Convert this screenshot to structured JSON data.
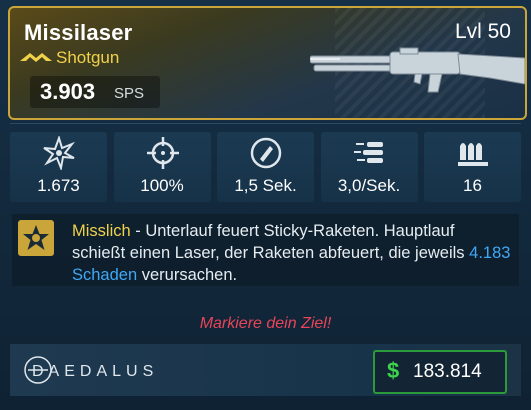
{
  "item": {
    "name": "Missilaser",
    "level": "Lvl 50",
    "type": "Shotgun",
    "dps_value": "3.903",
    "dps_unit": "SPS"
  },
  "stats": [
    {
      "icon": "burst-icon",
      "value": "1.673"
    },
    {
      "icon": "crosshair-icon",
      "value": "100%"
    },
    {
      "icon": "reload-icon",
      "value": "1,5 Sek."
    },
    {
      "icon": "fire-rate-icon",
      "value": "3,0/Sek."
    },
    {
      "icon": "magazine-icon",
      "value": "16"
    }
  ],
  "perk": {
    "name": "Misslich",
    "text_1": " - Unterlauf feuert Sticky-Raketen. Hauptlauf schießt einen Laser, der Raketen abfeuert, die jeweils ",
    "damage": "4.183 Schaden",
    "text_2": " verursachen."
  },
  "flavor_text": "Markiere dein Ziel!",
  "manufacturer": "DAEDALUS",
  "price": {
    "symbol": "$",
    "value": "183.814"
  },
  "colors": {
    "rarity_accent": "#f0d24a",
    "damage_blue": "#3fa9f5",
    "flavor_red": "#e8445a",
    "price_green": "#3cd44a"
  }
}
